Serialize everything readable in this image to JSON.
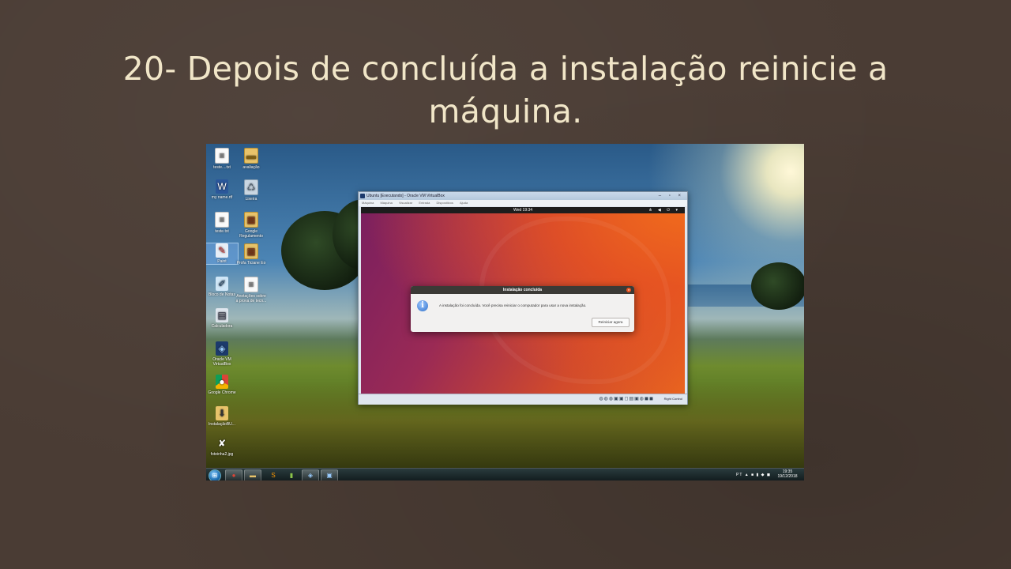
{
  "slide": {
    "title_line1": "20- Depois de concluída a instalação reinicie a",
    "title_line2": "máquina."
  },
  "desktop": {
    "icons": [
      {
        "label": "teste....txt",
        "icon": "text-file-icon"
      },
      {
        "label": "avaliação",
        "icon": "folder-icon"
      },
      {
        "label": "my name.rtf",
        "icon": "word-document-icon"
      },
      {
        "label": "Lixeira",
        "icon": "recycle-bin-icon"
      },
      {
        "label": "teste.txt",
        "icon": "text-file-icon"
      },
      {
        "label": "Google Regulamento",
        "icon": "zip-folder-icon"
      },
      {
        "label": "Paint",
        "icon": "paint-icon"
      },
      {
        "label": "Profa Ticiane Eo",
        "icon": "zip-folder-icon"
      },
      {
        "label": "Bloco de Notas",
        "icon": "notepad-icon"
      },
      {
        "label": "Anotações sobre a prova de tecn...",
        "icon": "text-file-icon"
      },
      {
        "label": "Calculadora",
        "icon": "calculator-icon"
      },
      {
        "label": "Oracle VM VirtualBox",
        "icon": "virtualbox-icon"
      },
      {
        "label": "Google Chrome",
        "icon": "chrome-icon"
      },
      {
        "label": "InstalaçãoBU...",
        "icon": "installer-icon"
      },
      {
        "label": "foteinha2.jpg",
        "icon": "image-file-icon"
      }
    ]
  },
  "taskbar": {
    "clock_time": "19:35",
    "clock_date": "19/12/2018",
    "tray_icons": "PT ▲ ■ ▮ ◆ ◼"
  },
  "vbox": {
    "title": "Ubuntu [Executando] - Oracle VM VirtualBox",
    "window_controls": "– ▫ ×",
    "menu": [
      "Máquina",
      "Máquina",
      "Visualizar",
      "Entrada",
      "Dispositivos",
      "Ajuda"
    ],
    "host_key": "Right Control",
    "status_icons": "◍◍◍▣▣◻▤▣◍◼◼"
  },
  "ubuntu": {
    "clock": "Wed 19:34",
    "sys_icons": "⋔ ◀ ⏻ ▾"
  },
  "dialog": {
    "title": "Instalação concluída",
    "message": "A instalação foi concluída. Você precisa reiniciar o computador para usar a nova instalação.",
    "button": "Reiniciar agora",
    "close": "×"
  },
  "colors": {
    "slide_bg": "#4a3c34",
    "title_text": "#f1e6c8",
    "ubuntu_orange": "#e95420",
    "ubuntu_aubergine": "#7a1f5f"
  }
}
